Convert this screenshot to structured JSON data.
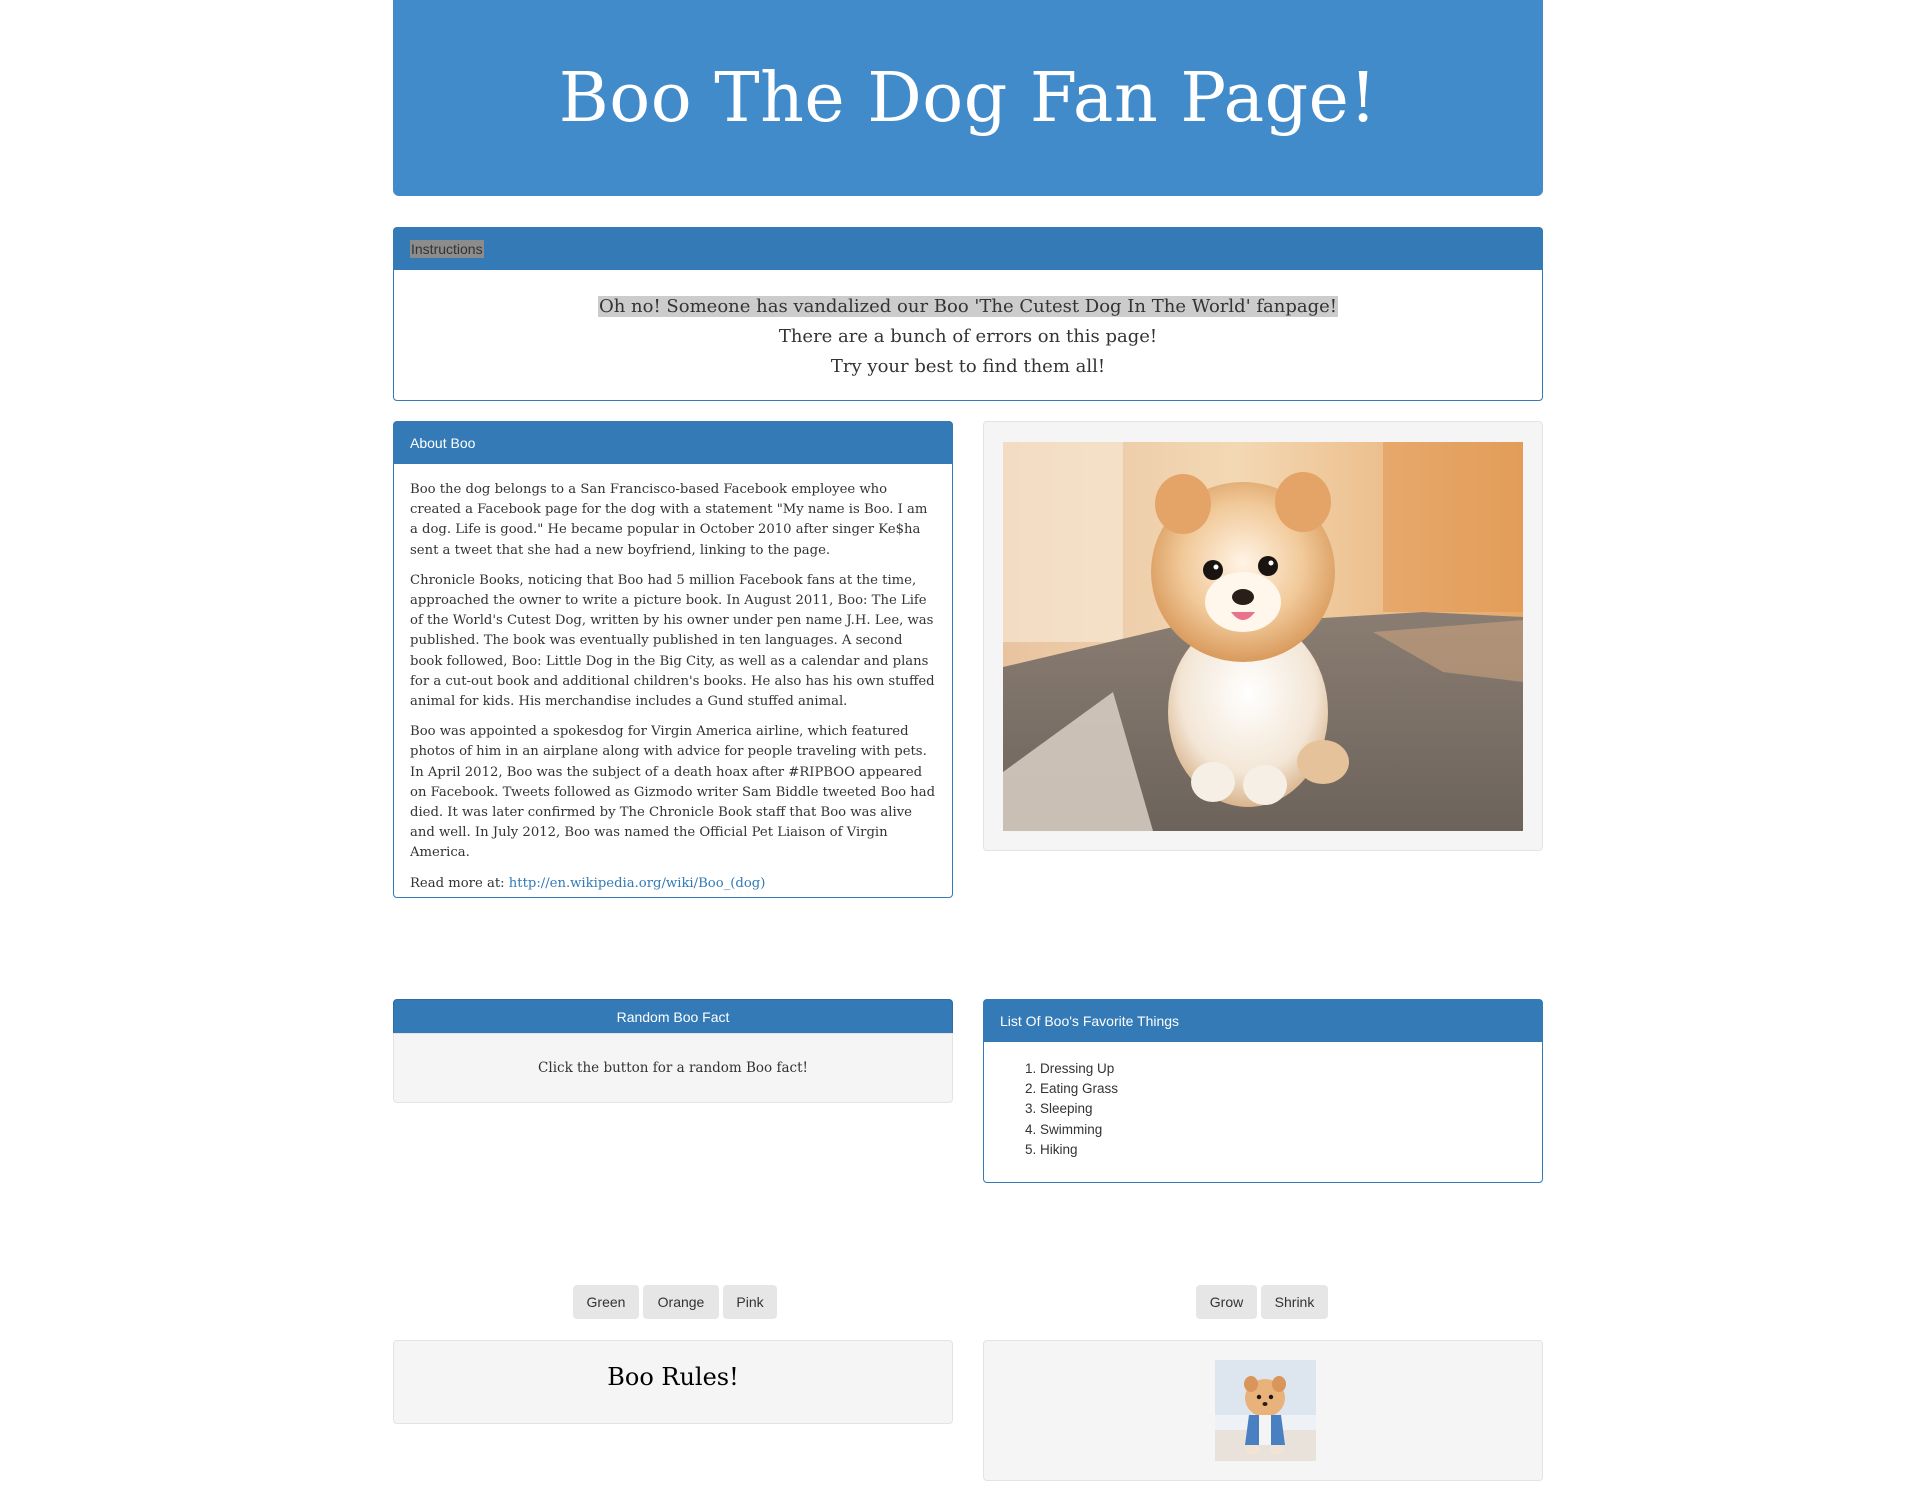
{
  "header": {
    "title": "Boo The Dog Fan Page!"
  },
  "instructions": {
    "heading": "Instructions",
    "lines": [
      "Oh no! Someone has vandalized our Boo 'The Cutest Dog In The World' fanpage!",
      "There are a bunch of errors on this page!",
      "Try your best to find them all!"
    ]
  },
  "about": {
    "heading": "About Boo",
    "paragraphs": [
      "Boo the dog belongs to a San Francisco-based Facebook employee who created a Facebook page for the dog with a statement \"My name is Boo. I am a dog. Life is good.\" He became popular in October 2010 after singer Ke$ha sent a tweet that she had a new boyfriend, linking to the page.",
      "Chronicle Books, noticing that Boo had 5 million Facebook fans at the time, approached the owner to write a picture book. In August 2011, Boo: The Life of the World's Cutest Dog, written by his owner under pen name J.H. Lee, was published. The book was eventually published in ten languages. A second book followed, Boo: Little Dog in the Big City, as well as a calendar and plans for a cut-out book and additional children's books. He also has his own stuffed animal for kids. His merchandise includes a Gund stuffed animal.",
      "Boo was appointed a spokesdog for Virgin America airline, which featured photos of him in an airplane along with advice for people traveling with pets. In April 2012, Boo was the subject of a death hoax after #RIPBOO appeared on Facebook. Tweets followed as Gizmodo writer Sam Biddle tweeted Boo had died. It was later confirmed by The Chronicle Book staff that Boo was alive and well. In July 2012, Boo was named the Official Pet Liaison of Virgin America."
    ],
    "read_more_label": "Read more at: ",
    "read_more_link": "http://en.wikipedia.org/wiki/Boo_(dog)"
  },
  "random_fact": {
    "button_label": "Random Boo Fact",
    "text": "Click the button for a random Boo fact!"
  },
  "favorites": {
    "heading": "List Of Boo's Favorite Things",
    "items": [
      "Dressing Up",
      "Eating Grass",
      "Sleeping",
      "Swimming",
      "Hiking"
    ]
  },
  "color_buttons": {
    "green": "Green",
    "orange": "Orange",
    "pink": "Pink"
  },
  "size_buttons": {
    "grow": "Grow",
    "shrink": "Shrink"
  },
  "rules": {
    "text": "Boo Rules!"
  },
  "colors": {
    "primary": "#428bca",
    "panel_heading": "#337ab7",
    "well_bg": "#f5f5f5",
    "button_bg": "#e6e6e6"
  }
}
